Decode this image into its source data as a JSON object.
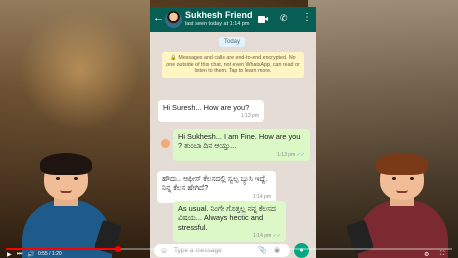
{
  "chat": {
    "contact_name": "Sukhesh Friend",
    "last_seen": "last seen today at 1:14 pm",
    "date_chip": "Today",
    "system_notice": "🔒 Messages and calls are end-to-end encrypted. No one outside of this chat, not even WhatsApp, can read or listen to them. Tap to learn more.",
    "messages": [
      {
        "direction": "in",
        "text": "Hi Suresh... How are you?",
        "time": "1:13 pm"
      },
      {
        "direction": "out",
        "text": "Hi Sukhesh... I am Fine. How are you ? ತುಂಬಾ ದಿನ ಆಯ್ತು...",
        "time": "1:13 pm"
      },
      {
        "direction": "in",
        "text": "ಹೌದು.. ಆಫೀಸ್ ಕೆಲಸದಲ್ಲಿ ಸ್ವಲ್ಪ ಬ್ಯುಸಿ ಇದ್ದೆ. ನಿನ್ನ ಕೆಲಸ ಹೇಗಿದೆ?",
        "time": "1:14 pm"
      },
      {
        "direction": "out",
        "text": "As usual. ನಿಂಗೇ ಗೊತ್ತಲ್ಲ ನನ್ನ ಕೆಲಸದ ವಿಷಯ... Always hectic and stressful.",
        "time": "1:14 pm"
      }
    ],
    "input_placeholder": "Type a message"
  },
  "icons": {
    "back": "back-arrow-icon",
    "video": "video-call-icon",
    "call": "phone-icon",
    "menu": "more-vert-icon",
    "emoji": "emoji-icon",
    "attach": "paperclip-icon",
    "camera": "camera-icon",
    "mic": "mic-icon"
  },
  "player": {
    "time": "0:55 / 1:20",
    "progress_fraction": 0.25
  },
  "colors": {
    "header": "#075e54",
    "outgoing_bubble": "#dcf8c6",
    "incoming_bubble": "#ffffff",
    "chat_bg": "#e5ddd5",
    "progress": "#ff0000"
  }
}
